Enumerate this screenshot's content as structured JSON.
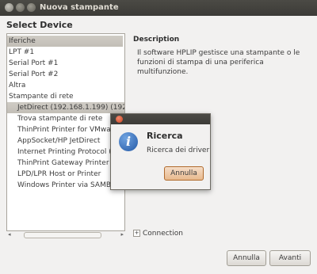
{
  "window": {
    "title": "Nuova stampante"
  },
  "heading": "Select Device",
  "device_list": {
    "items": [
      {
        "label": "Iferiche",
        "selected": true,
        "indent": false
      },
      {
        "label": "LPT #1",
        "indent": false
      },
      {
        "label": "Serial Port #1",
        "indent": false
      },
      {
        "label": "Serial Port #2",
        "indent": false
      },
      {
        "label": "Altra",
        "indent": false
      },
      {
        "label": "Stampante di rete",
        "indent": false
      },
      {
        "label": "JetDirect (192.168.1.199) (192.16",
        "indent": true,
        "highlight": true
      },
      {
        "label": "Trova stampante di rete",
        "indent": true
      },
      {
        "label": "ThinPrint Printer for VMware",
        "indent": true
      },
      {
        "label": "AppSocket/HP JetDirect",
        "indent": true
      },
      {
        "label": "Internet Printing Protocol (ipp",
        "indent": true
      },
      {
        "label": "ThinPrint Gateway Printer fo",
        "indent": true
      },
      {
        "label": "LPD/LPR Host or Printer",
        "indent": true
      },
      {
        "label": "Windows Printer via SAMBA",
        "indent": true
      }
    ]
  },
  "description": {
    "title": "Description",
    "text": "Il software HPLIP gestisce una stampante o le funzioni di stampa di una periferica multifunzione."
  },
  "connection": {
    "label": "Connection",
    "expander": "+"
  },
  "buttons": {
    "cancel": "Annulla",
    "forward": "Avanti"
  },
  "popup": {
    "title": "Ricerca",
    "message": "Ricerca dei driver",
    "cancel": "Annulla",
    "icon": "info-icon"
  }
}
